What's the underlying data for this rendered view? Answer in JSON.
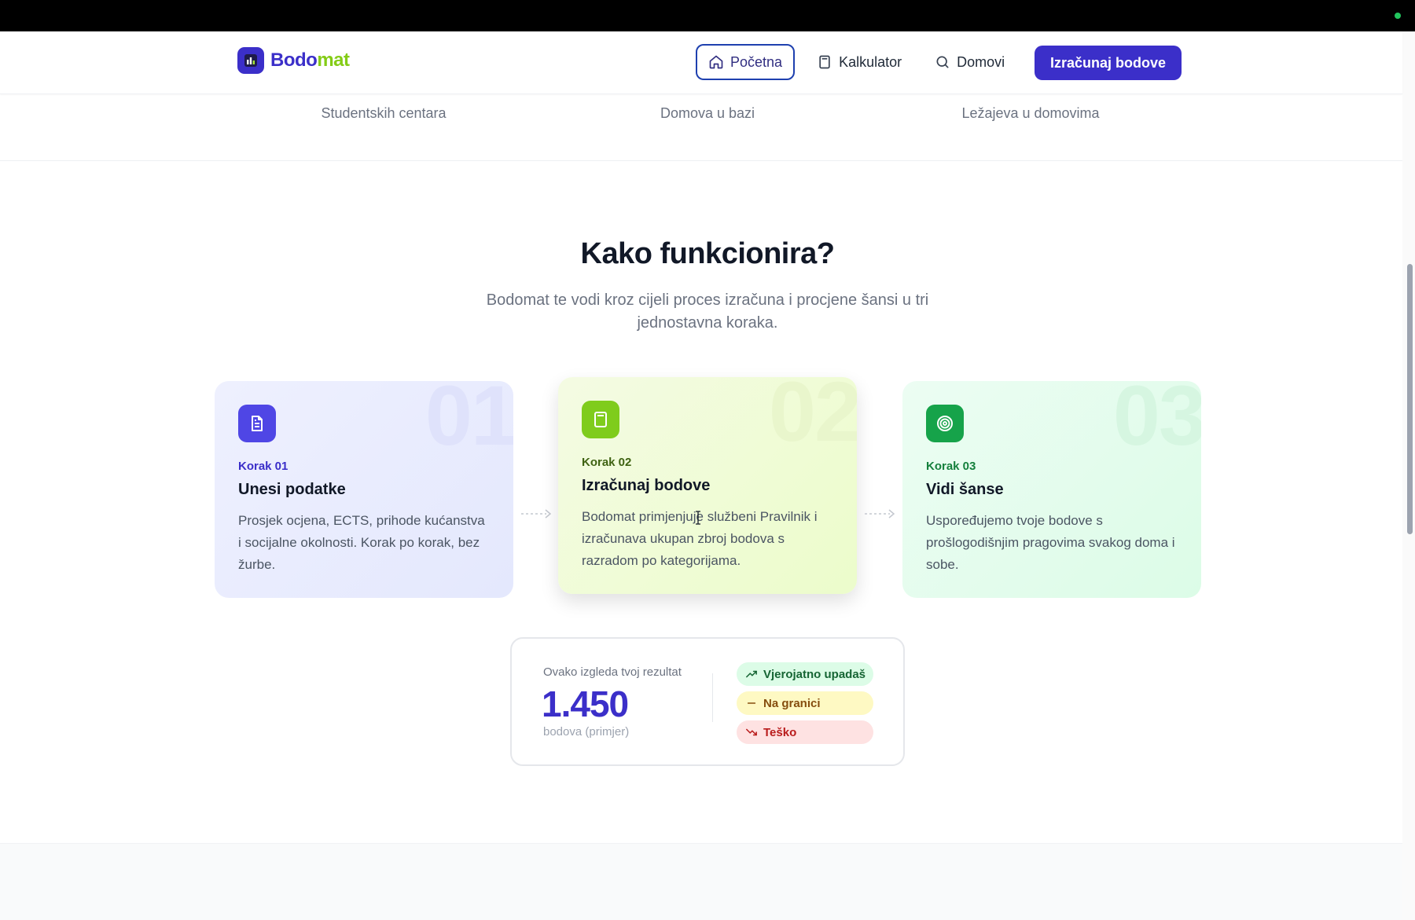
{
  "brand": {
    "name_part1": "Bodo",
    "name_part2": "mat",
    "color_primary": "#3b2fc9",
    "color_accent": "#84cc16"
  },
  "nav": {
    "items": [
      {
        "label": "Početna",
        "icon": "home-icon",
        "active": true
      },
      {
        "label": "Kalkulator",
        "icon": "calculator-icon",
        "active": false
      },
      {
        "label": "Domovi",
        "icon": "search-icon",
        "active": false
      }
    ],
    "cta_label": "Izračunaj bodove"
  },
  "stats": {
    "labels": [
      "Studentskih centara",
      "Domova u bazi",
      "Ležajeva u domovima"
    ]
  },
  "section": {
    "title": "Kako funkcionira?",
    "subtitle": "Bodomat te vodi kroz cijeli proces izračuna i procjene šansi u tri jednostavna koraka."
  },
  "steps": [
    {
      "number": "01",
      "step_label": "Korak 01",
      "title": "Unesi podatke",
      "description": "Prosjek ocjena, ECTS, prihode kućanstva i socijalne okolnosti. Korak po korak, bez žurbe.",
      "icon": "document-icon",
      "color": "#4f46e5"
    },
    {
      "number": "02",
      "step_label": "Korak 02",
      "title": "Izračunaj bodove",
      "description": "Bodomat primjenjuje službeni Pravilnik i izračunava ukupan zbroj bodova s razradom po kategorijama.",
      "icon": "calculator-icon",
      "color": "#7fcc1c"
    },
    {
      "number": "03",
      "step_label": "Korak 03",
      "title": "Vidi šanse",
      "description": "Uspoređujemo tvoje bodove s prošlogodišnjim pragovima svakog doma i sobe.",
      "icon": "target-icon",
      "color": "#16a34a"
    }
  ],
  "result": {
    "caption": "Ovako izgleda tvoj rezultat",
    "value": "1.450",
    "unit": "bodova (primjer)",
    "outcomes": [
      {
        "label": "Vjerojatno upadaš",
        "icon": "trend-up-icon",
        "color": "#166534"
      },
      {
        "label": "Na granici",
        "icon": "minus-icon",
        "color": "#854d0e"
      },
      {
        "label": "Teško",
        "icon": "trend-down-icon",
        "color": "#b91c1c"
      }
    ]
  }
}
